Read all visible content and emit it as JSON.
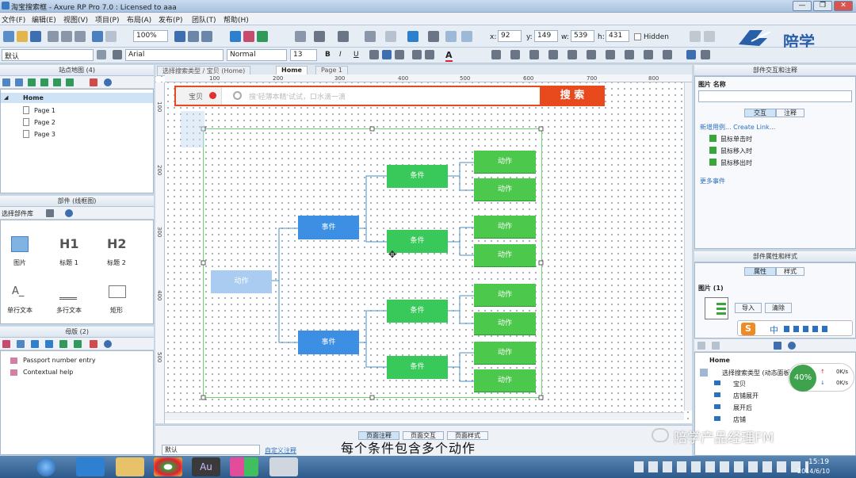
{
  "window": {
    "title": "淘宝搜索框 - Axure RP Pro 7.0 : Licensed to aaa",
    "controls": [
      "—",
      "❐",
      "✕"
    ]
  },
  "menu": [
    "文件(F)",
    "编辑(E)",
    "视图(V)",
    "项目(P)",
    "布局(A)",
    "发布(P)",
    "团队(T)",
    "帮助(H)"
  ],
  "toolbar": {
    "zoom": "100%",
    "x_label": "x:",
    "x": "92",
    "y_label": "y:",
    "y": "149",
    "w_label": "w:",
    "w": "539",
    "h_label": "h:",
    "h": "431",
    "hidden": "Hidden"
  },
  "format": {
    "style": "默认",
    "font": "Arial",
    "weight": "Normal",
    "size": "13"
  },
  "logo": "陪学",
  "sitemap": {
    "title": "站点地图 (4)",
    "pages": [
      "Home",
      "Page 1",
      "Page 2",
      "Page 3"
    ]
  },
  "widgets": {
    "title": "部件 (线框图)",
    "library": "选择部件库",
    "items": [
      "图片",
      "标题 1",
      "标题 2",
      "单行文本",
      "多行文本",
      "矩形"
    ],
    "h1": "H1",
    "h2": "H2"
  },
  "masters": {
    "title": "母版 (2)",
    "items": [
      "Passport number entry",
      "Contextual help"
    ]
  },
  "tabs": [
    "选择搜索类型 / 宝贝 (Home)",
    "Home",
    "Page 1"
  ],
  "ruler": {
    "h": [
      "100",
      "200",
      "300",
      "400",
      "500",
      "600",
      "700",
      "800"
    ],
    "v": [
      "100",
      "200",
      "300",
      "400",
      "500"
    ]
  },
  "design": {
    "search_tab": "宝贝",
    "search_placeholder": "搜'轻薄本精'试试，口水滴一滴",
    "search_button": "搜 索",
    "root": "动作",
    "events": [
      "事件",
      "事件"
    ],
    "conditions": [
      "条件",
      "条件",
      "条件",
      "条件"
    ],
    "actions": [
      "动作",
      "动作",
      "动作",
      "动作",
      "动作",
      "动作",
      "动作",
      "动作"
    ]
  },
  "bottom": {
    "tabs": [
      "页面注释",
      "页面交互",
      "页面样式"
    ],
    "default": "默认",
    "custom": "自定义注释"
  },
  "interaction": {
    "title": "部件交互和注释",
    "label": "图片  名称",
    "tabs": [
      "交互",
      "注释"
    ],
    "links": "新增用例... Create Link...",
    "events": [
      "鼠标单击时",
      "鼠标移入时",
      "鼠标移出时"
    ],
    "more": "更多事件"
  },
  "props": {
    "title": "部件属性和样式",
    "tabs": [
      "属性",
      "样式"
    ],
    "section": "图片 (1)",
    "import": "导入",
    "clear": "清除"
  },
  "outline": {
    "root": "Home",
    "items": [
      "选择搜索类型 (动态面板)",
      "宝贝",
      "店铺展开",
      "展开后",
      "店铺"
    ]
  },
  "network": {
    "percent": "40%",
    "up": "0K/s",
    "down": "0K/s"
  },
  "taskbar": {
    "time": "15:19",
    "date": "2014/6/10"
  },
  "watermark": "陪学产品经理FM",
  "subtitle": "每个条件包含多个动作"
}
